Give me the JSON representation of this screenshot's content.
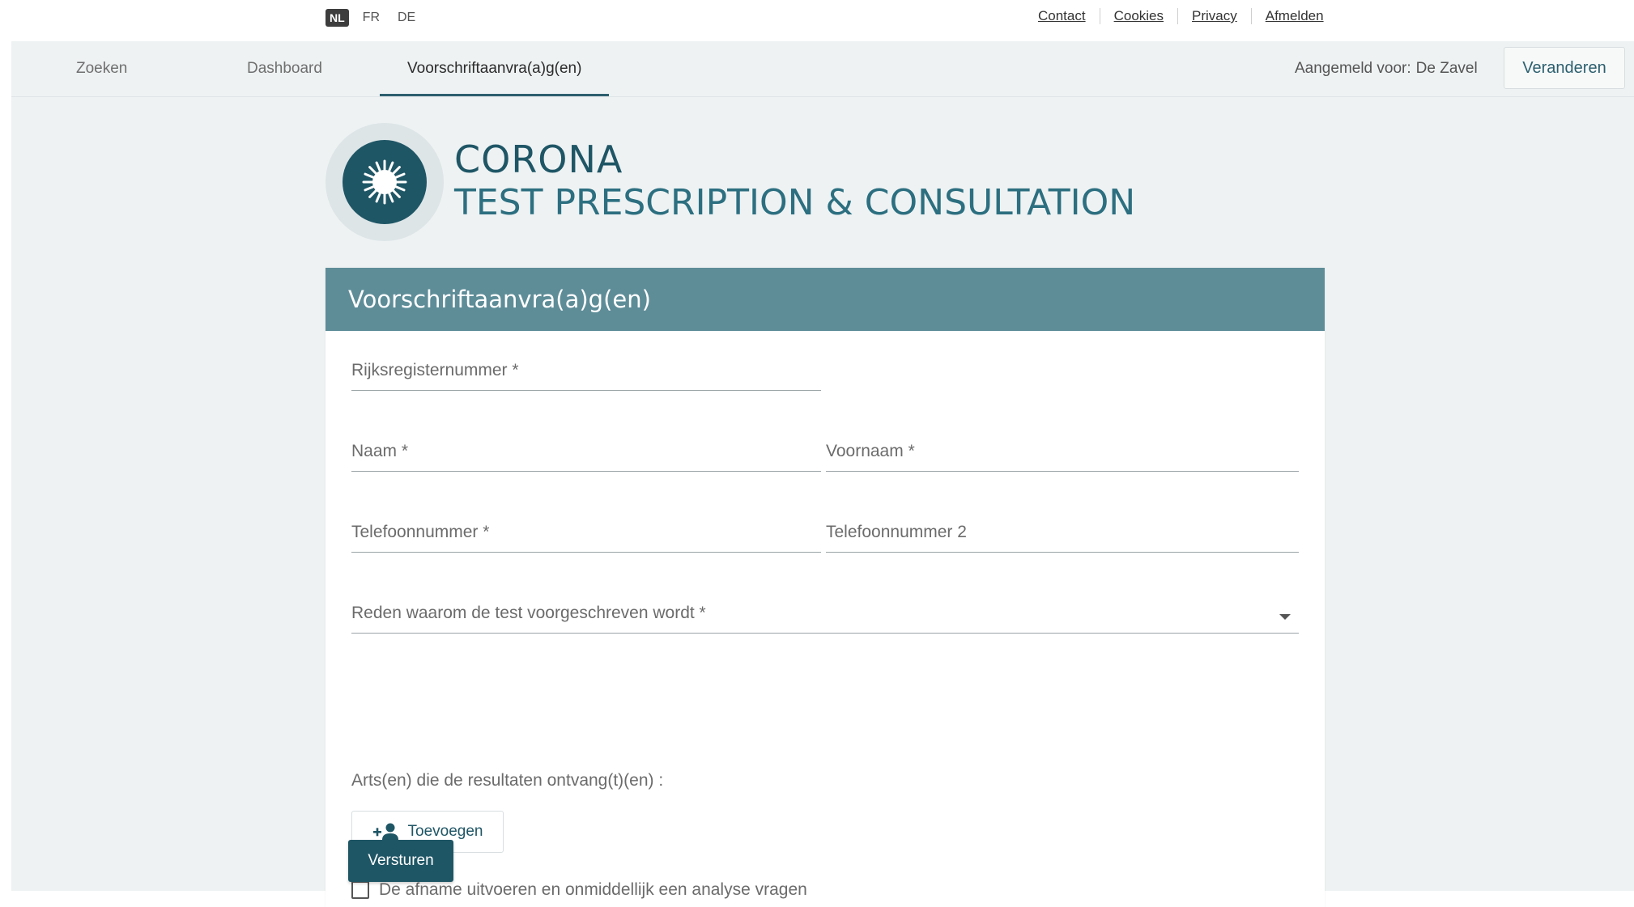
{
  "languages": [
    {
      "code": "NL",
      "active": true
    },
    {
      "code": "FR",
      "active": false
    },
    {
      "code": "DE",
      "active": false
    }
  ],
  "top_links": [
    "Contact",
    "Cookies",
    "Privacy",
    "Afmelden"
  ],
  "nav": {
    "tabs": [
      "Zoeken",
      "Dashboard",
      "Voorschriftaanvra(a)g(en)"
    ],
    "active_tab": "Voorschriftaanvra(a)g(en)",
    "logged_in_label": "Aangemeld voor:",
    "logged_in_user": "De Zavel",
    "change_button": "Veranderen"
  },
  "brand": {
    "line1": "CORONA",
    "line2": "TEST PRESCRIPTION & CONSULTATION",
    "logo_icon": "virus-icon"
  },
  "form": {
    "title": "Voorschriftaanvra(a)g(en)",
    "fields": {
      "national_register": "Rijksregisternummer *",
      "last_name": "Naam *",
      "first_name": "Voornaam *",
      "phone": "Telefoonnummer *",
      "phone2": "Telefoonnummer 2",
      "reason": "Reden waarom de test voorgeschreven wordt *"
    },
    "doctors_label": "Arts(en) die de resultaten ontvang(t)(en) :",
    "add_button": "Toevoegen",
    "add_icon": "add-person-icon",
    "checkbox_label": "De afname uitvoeren en onmiddellijk een analyse vragen",
    "checkbox_checked": false,
    "submit_button": "Versturen"
  },
  "colors": {
    "primary": "#1f5666",
    "header_bg": "#5e8d98",
    "page_bg": "#eef2f3"
  }
}
